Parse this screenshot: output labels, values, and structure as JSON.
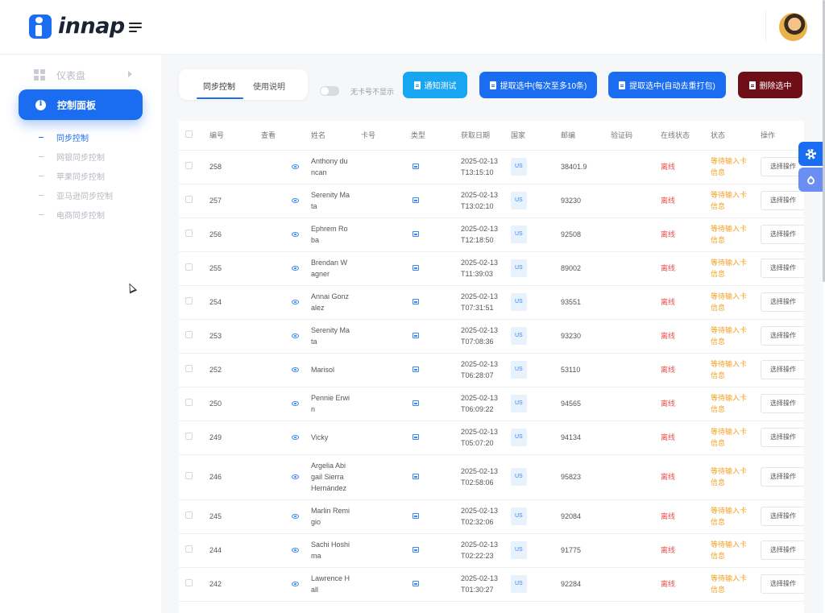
{
  "header": {
    "logo_text": "innap"
  },
  "sidebar": {
    "dashboard_label": "仪表盘",
    "active_label": "控制面板",
    "subitems": [
      "同步控制",
      "网银同步控制",
      "苹果同步控制",
      "亚马逊同步控制",
      "电商同步控制"
    ]
  },
  "tabs": [
    "同步控制",
    "使用说明"
  ],
  "toolbar": {
    "toggle_label": "无卡号不显示",
    "notify_label": "通知测试",
    "extract_label": "提取选中(每次至多10条)",
    "extract_auto_label": "提取选中(自动去重打包)",
    "delete_label": "删除选中"
  },
  "table": {
    "columns": [
      "编号",
      "查看",
      "姓名",
      "卡号",
      "类型",
      "获取日期",
      "国家",
      "邮编",
      "验证码",
      "在线状态",
      "状态",
      "操作"
    ],
    "rows": [
      {
        "id": "258",
        "name": [
          "Anthony du",
          "ncan"
        ],
        "date": "2025-02-13",
        "time": "T13:15:10",
        "country": "US",
        "zip": "38401.9",
        "online": "离线",
        "status": [
          "等待输入卡",
          "信息"
        ],
        "op": "选择操作"
      },
      {
        "id": "257",
        "name": [
          "Serenity Ma",
          "ta"
        ],
        "date": "2025-02-13",
        "time": "T13:02:10",
        "country": "US",
        "zip": "93230",
        "online": "离线",
        "status": [
          "等待输入卡",
          "信息"
        ],
        "op": "选择操作"
      },
      {
        "id": "256",
        "name": [
          "Ephrem Ro",
          "ba"
        ],
        "date": "2025-02-13",
        "time": "T12:18:50",
        "country": "US",
        "zip": "92508",
        "online": "离线",
        "status": [
          "等待输入卡",
          "信息"
        ],
        "op": "选择操作"
      },
      {
        "id": "255",
        "name": [
          "Brendan W",
          "agner"
        ],
        "date": "2025-02-13",
        "time": "T11:39:03",
        "country": "US",
        "zip": "89002",
        "online": "离线",
        "status": [
          "等待输入卡",
          "信息"
        ],
        "op": "选择操作"
      },
      {
        "id": "254",
        "name": [
          "Annai Gonz",
          "alez"
        ],
        "date": "2025-02-13",
        "time": "T07:31:51",
        "country": "US",
        "zip": "93551",
        "online": "离线",
        "status": [
          "等待输入卡",
          "信息"
        ],
        "op": "选择操作"
      },
      {
        "id": "253",
        "name": [
          "Serenity Ma",
          "ta"
        ],
        "date": "2025-02-13",
        "time": "T07:08:36",
        "country": "US",
        "zip": "93230",
        "online": "离线",
        "status": [
          "等待输入卡",
          "信息"
        ],
        "op": "选择操作"
      },
      {
        "id": "252",
        "name": [
          "Marisol"
        ],
        "date": "2025-02-13",
        "time": "T06:28:07",
        "country": "US",
        "zip": "53110",
        "online": "离线",
        "status": [
          "等待输入卡",
          "信息"
        ],
        "op": "选择操作"
      },
      {
        "id": "250",
        "name": [
          "Pennie Erwi",
          "n"
        ],
        "date": "2025-02-13",
        "time": "T06:09:22",
        "country": "US",
        "zip": "94565",
        "online": "离线",
        "status": [
          "等待输入卡",
          "信息"
        ],
        "op": "选择操作"
      },
      {
        "id": "249",
        "name": [
          "Vicky"
        ],
        "date": "2025-02-13",
        "time": "T05:07:20",
        "country": "US",
        "zip": "94134",
        "online": "离线",
        "status": [
          "等待输入卡",
          "信息"
        ],
        "op": "选择操作"
      },
      {
        "id": "246",
        "name": [
          "Argelia Abi",
          "gail Sierra",
          "Hernández"
        ],
        "date": "2025-02-13",
        "time": "T02:58:06",
        "country": "US",
        "zip": "95823",
        "online": "离线",
        "status": [
          "等待输入卡",
          "信息"
        ],
        "op": "选择操作"
      },
      {
        "id": "245",
        "name": [
          "Marlin Remi",
          "gio"
        ],
        "date": "2025-02-13",
        "time": "T02:32:06",
        "country": "US",
        "zip": "92084",
        "online": "离线",
        "status": [
          "等待输入卡",
          "信息"
        ],
        "op": "选择操作"
      },
      {
        "id": "244",
        "name": [
          "Sachi Hoshi",
          "ma"
        ],
        "date": "2025-02-13",
        "time": "T02:22:23",
        "country": "US",
        "zip": "91775",
        "online": "离线",
        "status": [
          "等待输入卡",
          "信息"
        ],
        "op": "选择操作"
      },
      {
        "id": "242",
        "name": [
          "Lawrence H",
          "all"
        ],
        "date": "2025-02-13",
        "time": "T01:30:27",
        "country": "US",
        "zip": "92284",
        "online": "离线",
        "status": [
          "等待输入卡",
          "信息"
        ],
        "op": "选择操作"
      }
    ]
  },
  "colors": {
    "primary": "#1a6cf0",
    "notify": "#18a6f2",
    "danger": "#6e0f18",
    "offline": "#f04b4b",
    "pending": "#f2a024"
  }
}
